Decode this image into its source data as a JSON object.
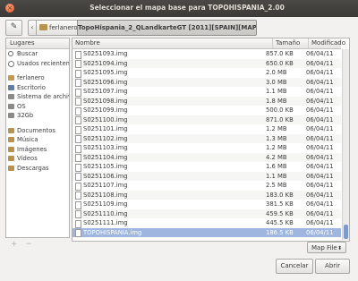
{
  "window": {
    "title": "Seleccionar el mapa base para TOPOHISPANIA_2.00"
  },
  "path": {
    "back_glyph": "‹",
    "crumbs": [
      "ferlanero",
      "TopoHispania_2_QLandkarteGT [2011][SPAIN][MAPS]"
    ]
  },
  "sidebar": {
    "header": "Lugares",
    "items": [
      {
        "label": "Buscar",
        "icon": "search-icon"
      },
      {
        "label": "Usados recientemente",
        "icon": "clock-icon"
      },
      {
        "label": "ferlanero",
        "icon": "home-icon"
      },
      {
        "label": "Escritorio",
        "icon": "desktop-icon"
      },
      {
        "label": "Sistema de archivos",
        "icon": "drive-icon"
      },
      {
        "label": "OS",
        "icon": "drive-icon"
      },
      {
        "label": "32Gb",
        "icon": "drive-icon"
      },
      {
        "label": "Documentos",
        "icon": "folder-icon"
      },
      {
        "label": "Música",
        "icon": "folder-icon"
      },
      {
        "label": "Imágenes",
        "icon": "folder-icon"
      },
      {
        "label": "Vídeos",
        "icon": "folder-icon"
      },
      {
        "label": "Descargas",
        "icon": "folder-icon"
      }
    ],
    "add_glyph": "+",
    "remove_glyph": "−"
  },
  "columns": {
    "name": "Nombre",
    "size": "Tamaño",
    "modified": "Modificado"
  },
  "files": [
    {
      "name": "S0251093.img",
      "size": "857.0 KB",
      "date": "06/04/11"
    },
    {
      "name": "S0251094.img",
      "size": "650.0 KB",
      "date": "06/04/11"
    },
    {
      "name": "S0251095.img",
      "size": "2.0 MB",
      "date": "06/04/11"
    },
    {
      "name": "S0251096.img",
      "size": "3.0 MB",
      "date": "06/04/11"
    },
    {
      "name": "S0251097.img",
      "size": "1.1 MB",
      "date": "06/04/11"
    },
    {
      "name": "S0251098.img",
      "size": "1.8 MB",
      "date": "06/04/11"
    },
    {
      "name": "S0251099.img",
      "size": "500.0 KB",
      "date": "06/04/11"
    },
    {
      "name": "S0251100.img",
      "size": "871.0 KB",
      "date": "06/04/11"
    },
    {
      "name": "S0251101.img",
      "size": "1.2 MB",
      "date": "06/04/11"
    },
    {
      "name": "S0251102.img",
      "size": "1.3 MB",
      "date": "06/04/11"
    },
    {
      "name": "S0251103.img",
      "size": "1.2 MB",
      "date": "06/04/11"
    },
    {
      "name": "S0251104.img",
      "size": "4.2 MB",
      "date": "06/04/11"
    },
    {
      "name": "S0251105.img",
      "size": "1.6 MB",
      "date": "06/04/11"
    },
    {
      "name": "S0251106.img",
      "size": "1.1 MB",
      "date": "06/04/11"
    },
    {
      "name": "S0251107.img",
      "size": "2.5 MB",
      "date": "06/04/11"
    },
    {
      "name": "S0251108.img",
      "size": "183.0 KB",
      "date": "06/04/11"
    },
    {
      "name": "S0251109.img",
      "size": "381.5 KB",
      "date": "06/04/11"
    },
    {
      "name": "S0251110.img",
      "size": "459.5 KB",
      "date": "06/04/11"
    },
    {
      "name": "S0251111.img",
      "size": "445.5 KB",
      "date": "06/04/11"
    },
    {
      "name": "TOPOHISPANIA.img",
      "size": "186.5 KB",
      "date": "06/04/11"
    }
  ],
  "selected_file": "TOPOHISPANIA.img",
  "filter": {
    "value": "Map File"
  },
  "buttons": {
    "cancel": "Cancelar",
    "open": "Abrir"
  }
}
